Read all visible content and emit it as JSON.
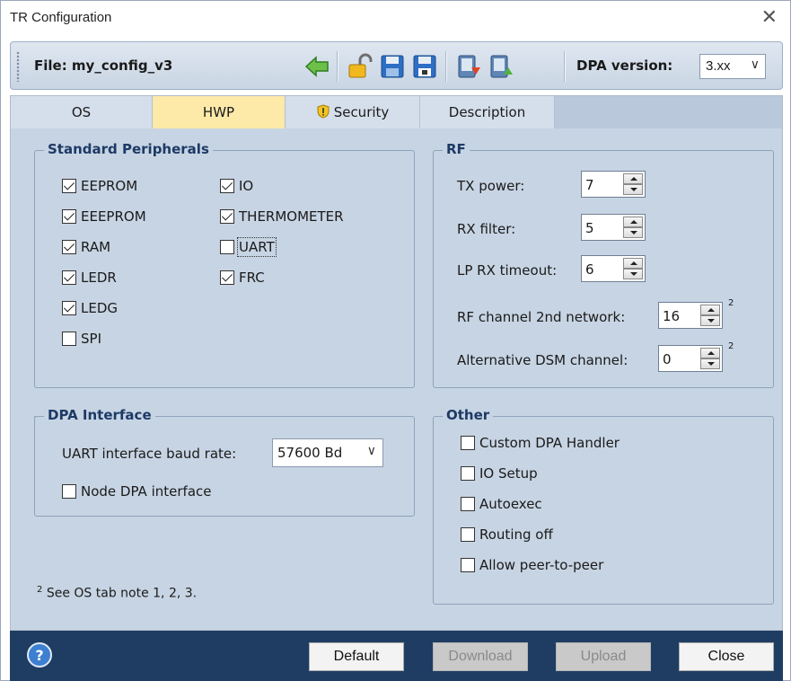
{
  "window": {
    "title": "TR Configuration",
    "close_glyph": "✕"
  },
  "toolbar": {
    "file_label": "File: my_config_v3",
    "icons": [
      "back-arrow-icon",
      "unlock-icon",
      "save-icon",
      "save-as-icon",
      "download-to-device-icon",
      "upload-from-device-icon"
    ],
    "dpa_label": "DPA version:",
    "dpa_value": "3.xx",
    "chevron": "⌵"
  },
  "tabs": [
    {
      "label": "OS",
      "active": false
    },
    {
      "label": "HWP",
      "active": true
    },
    {
      "label": "Security",
      "active": false,
      "icon": "shield-warning-icon"
    },
    {
      "label": "Description",
      "active": false
    }
  ],
  "standard_peripherals": {
    "title": "Standard Peripherals",
    "items": [
      {
        "label": "EEPROM",
        "checked": true
      },
      {
        "label": "EEEPROM",
        "checked": true
      },
      {
        "label": "RAM",
        "checked": true
      },
      {
        "label": "LEDR",
        "checked": true
      },
      {
        "label": "LEDG",
        "checked": true
      },
      {
        "label": "SPI",
        "checked": false
      },
      {
        "label": "IO",
        "checked": true
      },
      {
        "label": "THERMOMETER",
        "checked": true
      },
      {
        "label": "UART",
        "checked": false
      },
      {
        "label": "FRC",
        "checked": true
      }
    ]
  },
  "rf": {
    "title": "RF",
    "tx_power": {
      "label": "TX power:",
      "value": "7"
    },
    "rx_filter": {
      "label": "RX filter:",
      "value": "5"
    },
    "lp_rx_timeout": {
      "label": "LP RX timeout:",
      "value": "6"
    },
    "rf_channel_2nd": {
      "label": "RF channel 2nd network:",
      "value": "16",
      "note": "2"
    },
    "alt_dsm_channel": {
      "label": "Alternative DSM channel:",
      "value": "0",
      "note": "2"
    }
  },
  "dpa_interface": {
    "title": "DPA Interface",
    "baud_label": "UART interface baud rate:",
    "baud_value": "57600 Bd",
    "node_dpa_label": "Node DPA interface",
    "node_dpa_checked": false
  },
  "other": {
    "title": "Other",
    "items": [
      {
        "label": "Custom DPA Handler",
        "checked": false
      },
      {
        "label": "IO Setup",
        "checked": false
      },
      {
        "label": "Autoexec",
        "checked": false
      },
      {
        "label": "Routing off",
        "checked": false
      },
      {
        "label": "Allow peer-to-peer",
        "checked": false
      }
    ]
  },
  "footnote": {
    "marker": "2",
    "text": "See OS tab note 1, 2, 3."
  },
  "buttons": {
    "default": "Default",
    "download": "Download",
    "upload": "Upload",
    "close": "Close"
  }
}
